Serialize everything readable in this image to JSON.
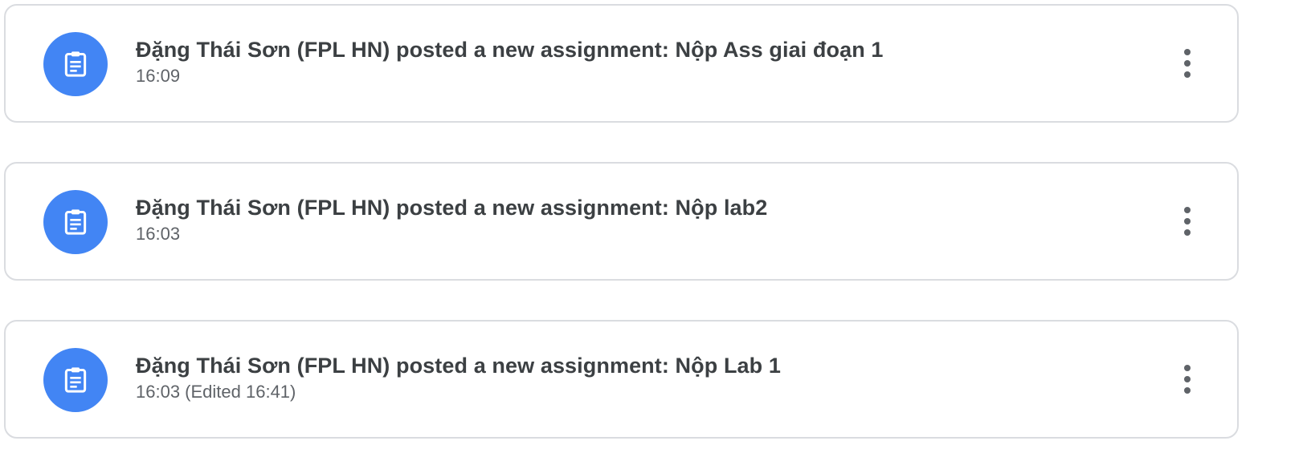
{
  "colors": {
    "accent": "#4285f4",
    "border": "#dadce0",
    "title_text": "#3c4043",
    "meta_text": "#5f6368"
  },
  "icons": {
    "avatar": "assignment-clipboard-icon",
    "menu": "more-vert-icon"
  },
  "stream": {
    "items": [
      {
        "title": "Đặng Thái Sơn (FPL HN) posted a new assignment: Nộp Ass giai đoạn 1",
        "meta": "16:09"
      },
      {
        "title": "Đặng Thái Sơn (FPL HN) posted a new assignment: Nộp lab2",
        "meta": "16:03"
      },
      {
        "title": "Đặng Thái Sơn (FPL HN) posted a new assignment: Nộp Lab 1",
        "meta": "16:03 (Edited 16:41)"
      }
    ]
  }
}
